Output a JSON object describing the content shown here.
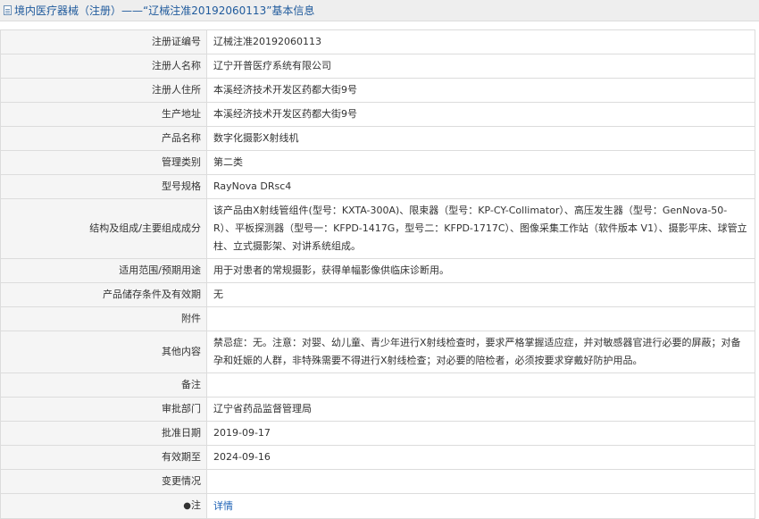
{
  "header": {
    "title": "境内医疗器械（注册）——“辽械注准20192060113”基本信息"
  },
  "rows": [
    {
      "label": "注册证编号",
      "value": "辽械注准20192060113"
    },
    {
      "label": "注册人名称",
      "value": "辽宁开普医疗系统有限公司"
    },
    {
      "label": "注册人住所",
      "value": "本溪经济技术开发区药都大街9号"
    },
    {
      "label": "生产地址",
      "value": "本溪经济技术开发区药都大街9号"
    },
    {
      "label": "产品名称",
      "value": "数字化摄影X射线机"
    },
    {
      "label": "管理类别",
      "value": "第二类"
    },
    {
      "label": "型号规格",
      "value": "RayNova DRsc4"
    },
    {
      "label": "结构及组成/主要组成成分",
      "value": "该产品由X射线管组件(型号：KXTA-300A)、限束器（型号：KP-CY-Collimator）、高压发生器（型号：GenNova-50-R）、平板探测器（型号一：KFPD-1417G，型号二：KFPD-1717C）、图像采集工作站（软件版本 V1）、摄影平床、球管立柱、立式摄影架、对讲系统组成。"
    },
    {
      "label": "适用范围/预期用途",
      "value": "用于对患者的常规摄影，获得单幅影像供临床诊断用。"
    },
    {
      "label": "产品储存条件及有效期",
      "value": "无"
    },
    {
      "label": "附件",
      "value": ""
    },
    {
      "label": "其他内容",
      "value": "禁忌症：无。注意：对婴、幼儿童、青少年进行X射线检查时，要求严格掌握适应症，并对敏感器官进行必要的屏蔽；对备孕和妊娠的人群，非特殊需要不得进行X射线检查；对必要的陪检者，必须按要求穿戴好防护用品。"
    },
    {
      "label": "备注",
      "value": ""
    },
    {
      "label": "审批部门",
      "value": "辽宁省药品监督管理局"
    },
    {
      "label": "批准日期",
      "value": "2019-09-17"
    },
    {
      "label": "有效期至",
      "value": "2024-09-16"
    },
    {
      "label": "变更情况",
      "value": ""
    }
  ],
  "note_row": {
    "label_pin": "●",
    "label": "注",
    "link": "详情"
  }
}
